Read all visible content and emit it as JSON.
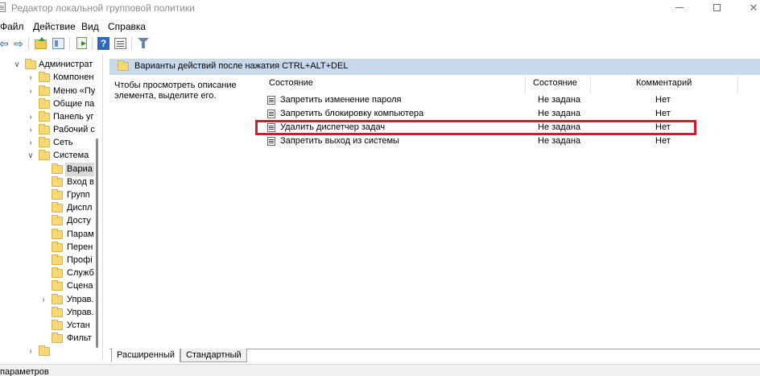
{
  "window": {
    "title": "Редактор локальной групповой политики",
    "minimize": "",
    "maximize": "",
    "close": "✕"
  },
  "menu": [
    "Файл",
    "Действие",
    "Вид",
    "Справка"
  ],
  "toolbar": {
    "icons": [
      "back-arrow",
      "forward-arrow",
      "up-folder",
      "show-hide-tree",
      "export-list",
      "help",
      "properties",
      "filter"
    ]
  },
  "tree": {
    "items": [
      {
        "label": "Администрат",
        "expanded": true
      },
      {
        "label": "Компонен",
        "expanded": false
      },
      {
        "label": "Меню «Пу",
        "expanded": false
      },
      {
        "label": "Общие па",
        "expanded": null
      },
      {
        "label": "Панель уг",
        "expanded": false
      },
      {
        "label": "Рабочий с",
        "expanded": false
      },
      {
        "label": "Сеть",
        "expanded": false
      },
      {
        "label": "Система",
        "expanded": true
      },
      {
        "label": "Вариа",
        "expanded": null,
        "selected": true
      },
      {
        "label": "Вход в",
        "expanded": null
      },
      {
        "label": "Групп",
        "expanded": null
      },
      {
        "label": "Диспл",
        "expanded": null
      },
      {
        "label": "Досту",
        "expanded": null
      },
      {
        "label": "Парам",
        "expanded": null
      },
      {
        "label": "Перен",
        "expanded": null
      },
      {
        "label": "Профі",
        "expanded": null
      },
      {
        "label": "Служб",
        "expanded": null
      },
      {
        "label": "Сцена",
        "expanded": null
      },
      {
        "label": "Управ.",
        "expanded": false
      },
      {
        "label": "Управ.",
        "expanded": null
      },
      {
        "label": "Устан",
        "expanded": null
      },
      {
        "label": "Фильт",
        "expanded": null
      },
      {
        "label": "",
        "expanded": false
      }
    ]
  },
  "main": {
    "header_title": "Варианты действий после нажатия CTRL+ALT+DEL",
    "description_line1": "Чтобы просмотреть описание",
    "description_line2": "элемента, выделите его.",
    "columns": {
      "name": "Состояние",
      "state": "Состояние",
      "comment": "Комментарий"
    },
    "rows": [
      {
        "name": "Запретить изменение пароля",
        "state": "Не задана",
        "comment": "Нет"
      },
      {
        "name": "Запретить блокировку компьютера",
        "state": "Не задана",
        "comment": "Нет"
      },
      {
        "name": "Удалить диспетчер задач",
        "state": "Не задана",
        "comment": "Нет",
        "highlighted": true
      },
      {
        "name": "Запретить выход из системы",
        "state": "Не задана",
        "comment": "Нет"
      }
    ],
    "highlight_color": "#e01525",
    "header_band_color": "#c9d9ec"
  },
  "tabs": {
    "extended": "Расширенный",
    "standard": "Стандартный"
  },
  "status": {
    "text": "параметров"
  }
}
